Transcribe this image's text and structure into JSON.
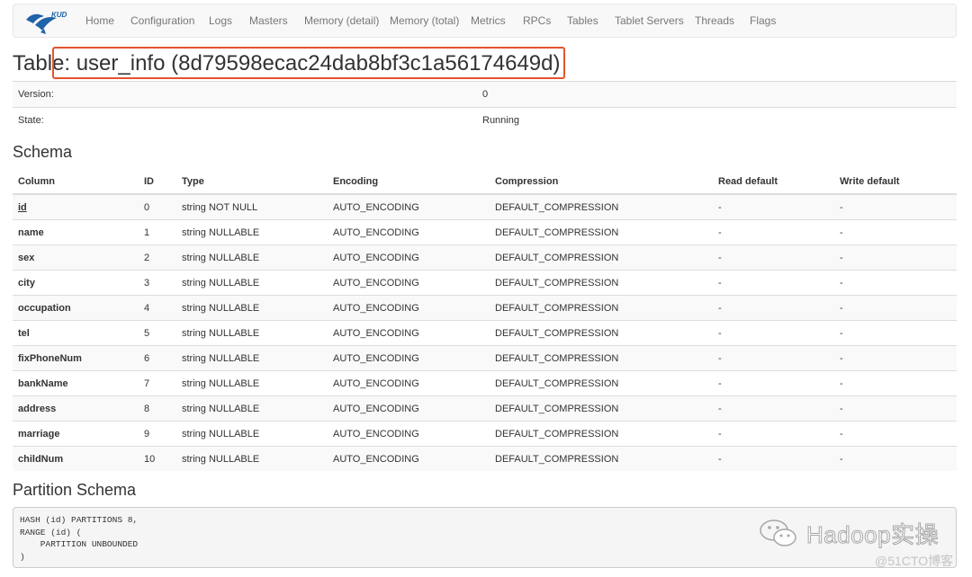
{
  "nav": {
    "logo_text": "KUDU",
    "items": [
      "Home",
      "Configuration",
      "Logs",
      "Masters",
      "Memory (detail)",
      "Memory (total)",
      "Metrics",
      "RPCs",
      "Tables",
      "Tablet Servers",
      "Threads",
      "Flags"
    ]
  },
  "page_title": "Table: user_info (8d79598ecac24dab8bf3c1a56174649d)",
  "info": [
    {
      "label": "Version:",
      "value": "0"
    },
    {
      "label": "State:",
      "value": "Running"
    }
  ],
  "schema": {
    "title": "Schema",
    "headers": [
      "Column",
      "ID",
      "Type",
      "Encoding",
      "Compression",
      "Read default",
      "Write default"
    ],
    "rows": [
      [
        "id",
        "0",
        "string NOT NULL",
        "AUTO_ENCODING",
        "DEFAULT_COMPRESSION",
        "-",
        "-"
      ],
      [
        "name",
        "1",
        "string NULLABLE",
        "AUTO_ENCODING",
        "DEFAULT_COMPRESSION",
        "-",
        "-"
      ],
      [
        "sex",
        "2",
        "string NULLABLE",
        "AUTO_ENCODING",
        "DEFAULT_COMPRESSION",
        "-",
        "-"
      ],
      [
        "city",
        "3",
        "string NULLABLE",
        "AUTO_ENCODING",
        "DEFAULT_COMPRESSION",
        "-",
        "-"
      ],
      [
        "occupation",
        "4",
        "string NULLABLE",
        "AUTO_ENCODING",
        "DEFAULT_COMPRESSION",
        "-",
        "-"
      ],
      [
        "tel",
        "5",
        "string NULLABLE",
        "AUTO_ENCODING",
        "DEFAULT_COMPRESSION",
        "-",
        "-"
      ],
      [
        "fixPhoneNum",
        "6",
        "string NULLABLE",
        "AUTO_ENCODING",
        "DEFAULT_COMPRESSION",
        "-",
        "-"
      ],
      [
        "bankName",
        "7",
        "string NULLABLE",
        "AUTO_ENCODING",
        "DEFAULT_COMPRESSION",
        "-",
        "-"
      ],
      [
        "address",
        "8",
        "string NULLABLE",
        "AUTO_ENCODING",
        "DEFAULT_COMPRESSION",
        "-",
        "-"
      ],
      [
        "marriage",
        "9",
        "string NULLABLE",
        "AUTO_ENCODING",
        "DEFAULT_COMPRESSION",
        "-",
        "-"
      ],
      [
        "childNum",
        "10",
        "string NULLABLE",
        "AUTO_ENCODING",
        "DEFAULT_COMPRESSION",
        "-",
        "-"
      ]
    ]
  },
  "partition": {
    "title": "Partition Schema",
    "code": "HASH (id) PARTITIONS 8,\nRANGE (id) (\n    PARTITION UNBOUNDED\n)"
  },
  "watermark": {
    "text": "Hadoop实操",
    "site": "@51CTO博客"
  },
  "colors": {
    "highlight_border": "#e5532d",
    "navbar_bg": "#f8f8f8",
    "logo_blue": "#1f63a8"
  }
}
